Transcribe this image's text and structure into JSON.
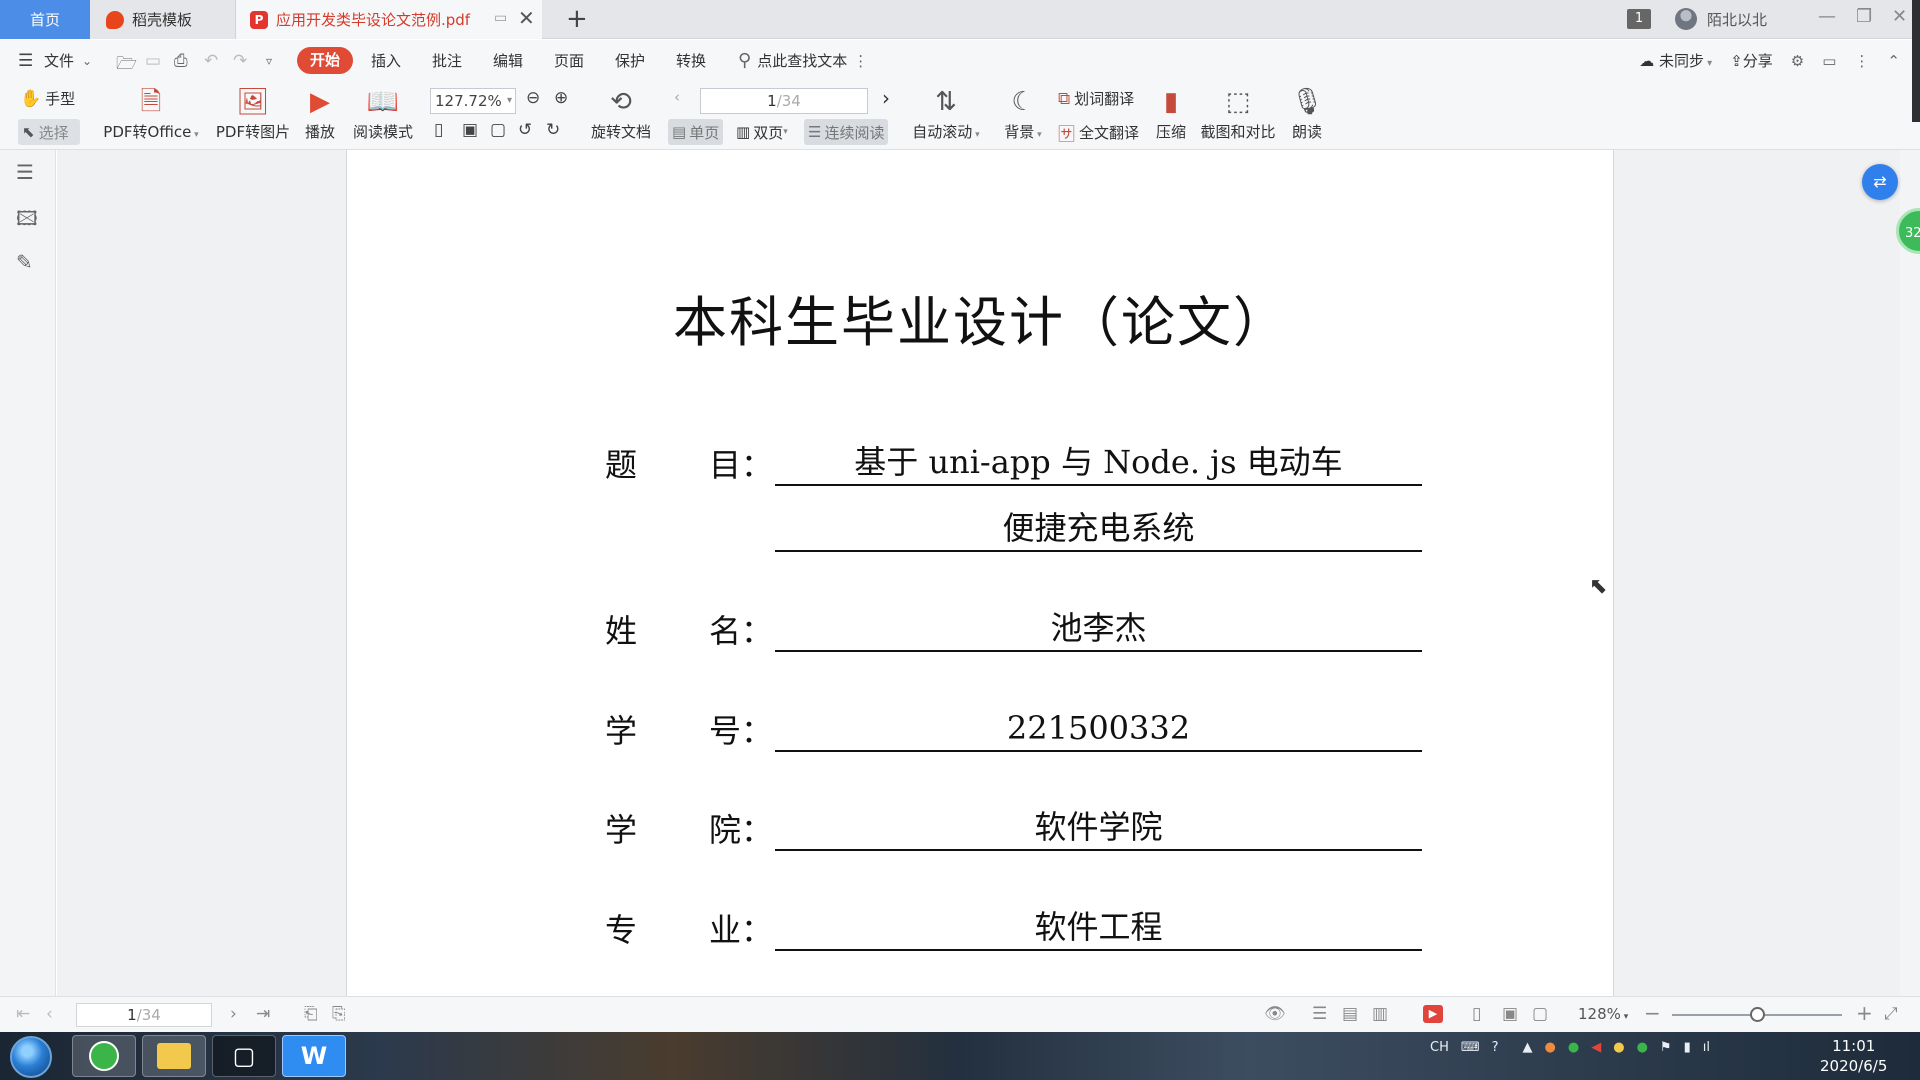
{
  "tabs": {
    "home": "首页",
    "template": "稻壳模板",
    "document": "应用开发类毕设论文范例.pdf",
    "add": "+"
  },
  "titlebar": {
    "window_count": "1",
    "username": "陌北以北"
  },
  "menu": {
    "file": "文件",
    "items": [
      "开始",
      "插入",
      "批注",
      "编辑",
      "页面",
      "保护",
      "转换"
    ],
    "search_placeholder": "点此查找文本",
    "sync": "未同步",
    "share": "分享"
  },
  "toolbar": {
    "hand": "手型",
    "select": "选择",
    "pdf_to_office": "PDF转Office",
    "pdf_to_image": "PDF转图片",
    "play": "播放",
    "read_mode": "阅读模式",
    "zoom": "127.72%",
    "rotate": "旋转文档",
    "page_current": "1",
    "page_total": "/34",
    "single_page": "单页",
    "double_page": "双页",
    "continuous": "连续阅读",
    "auto_scroll": "自动滚动",
    "background": "背景",
    "word_translate": "划词翻译",
    "full_translate": "全文翻译",
    "compress": "压缩",
    "screenshot_compare": "截图和对比",
    "read_aloud": "朗读"
  },
  "document": {
    "title": "本科生毕业设计（论文）",
    "fields": [
      {
        "label_a": "题",
        "label_b": "目：",
        "value": "基于 uni-app 与 Node. js 电动车"
      },
      {
        "label_a": "",
        "label_b": "",
        "value": "便捷充电系统"
      },
      {
        "label_a": "姓",
        "label_b": "名：",
        "value": "池李杰"
      },
      {
        "label_a": "学",
        "label_b": "号：",
        "value": "221500332"
      },
      {
        "label_a": "学",
        "label_b": "院：",
        "value": "软件学院"
      },
      {
        "label_a": "专",
        "label_b": "业：",
        "value": "软件工程"
      }
    ]
  },
  "floating": {
    "green_badge": "32"
  },
  "statusbar": {
    "page_current": "1",
    "page_total": "/34",
    "zoom": "128%"
  },
  "taskbar": {
    "lang": "CH",
    "time": "11:01",
    "date": "2020/6/5"
  },
  "colors": {
    "accent_red": "#e04b36",
    "tab_blue": "#4c8de8"
  }
}
